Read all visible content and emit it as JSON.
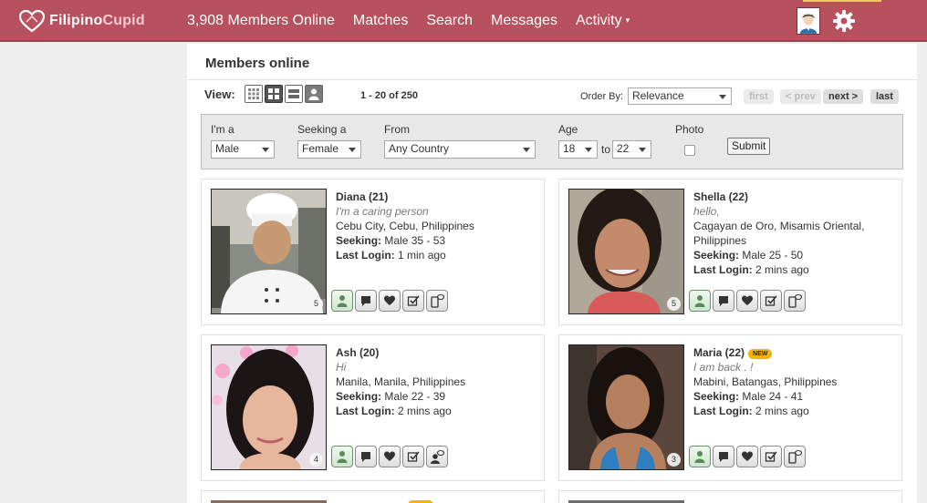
{
  "brand": {
    "name_part1": "Filipino",
    "name_part2": "Cupid",
    "primary": "#b7515e",
    "accent": "#f2c94c"
  },
  "nav": {
    "members_online": "3,908 Members Online",
    "matches": "Matches",
    "search": "Search",
    "messages": "Messages",
    "activity": "Activity",
    "activity_caret": "▾"
  },
  "page": {
    "title": "Members online"
  },
  "view": {
    "label": "View:",
    "range": "1 - 20 of 250"
  },
  "order": {
    "label": "Order By:",
    "value": "Relevance"
  },
  "pager": {
    "first": "first",
    "prev": "< prev",
    "next": "next >",
    "last": "last"
  },
  "filters": {
    "im_a_label": "I'm a",
    "im_a_value": "Male",
    "seeking_label": "Seeking a",
    "seeking_value": "Female",
    "from_label": "From",
    "from_value": "Any Country",
    "age_label": "Age",
    "age_min": "18",
    "age_to": "to",
    "age_max": "22",
    "photo_label": "Photo",
    "submit": "Submit"
  },
  "labels": {
    "seeking": "Seeking:",
    "last_login": "Last Login:"
  },
  "members": [
    {
      "name": "Diana (21)",
      "tagline": "I'm a caring person",
      "location": "Cebu City, Cebu, Philippines",
      "seeking": "Male 35 - 53",
      "last_login": "1 min ago",
      "photos": "5"
    },
    {
      "name": "Shella (22)",
      "tagline": "hello,",
      "location": "Cagayan de Oro, Misamis Oriental, Philippines",
      "seeking": "Male 25 - 50",
      "last_login": "2 mins ago",
      "photos": "5"
    },
    {
      "name": "Ash (20)",
      "tagline": "Hi",
      "location": "Manila, Manila, Philippines",
      "seeking": "Male 22 - 39",
      "last_login": "2 mins ago",
      "photos": "4"
    },
    {
      "name": "Maria (22)",
      "badge": "NEW",
      "tagline": "I am back . !",
      "location": "Mabini, Batangas, Philippines",
      "seeking": "Male 24 - 41",
      "last_login": "2 mins ago",
      "photos": "3"
    }
  ]
}
